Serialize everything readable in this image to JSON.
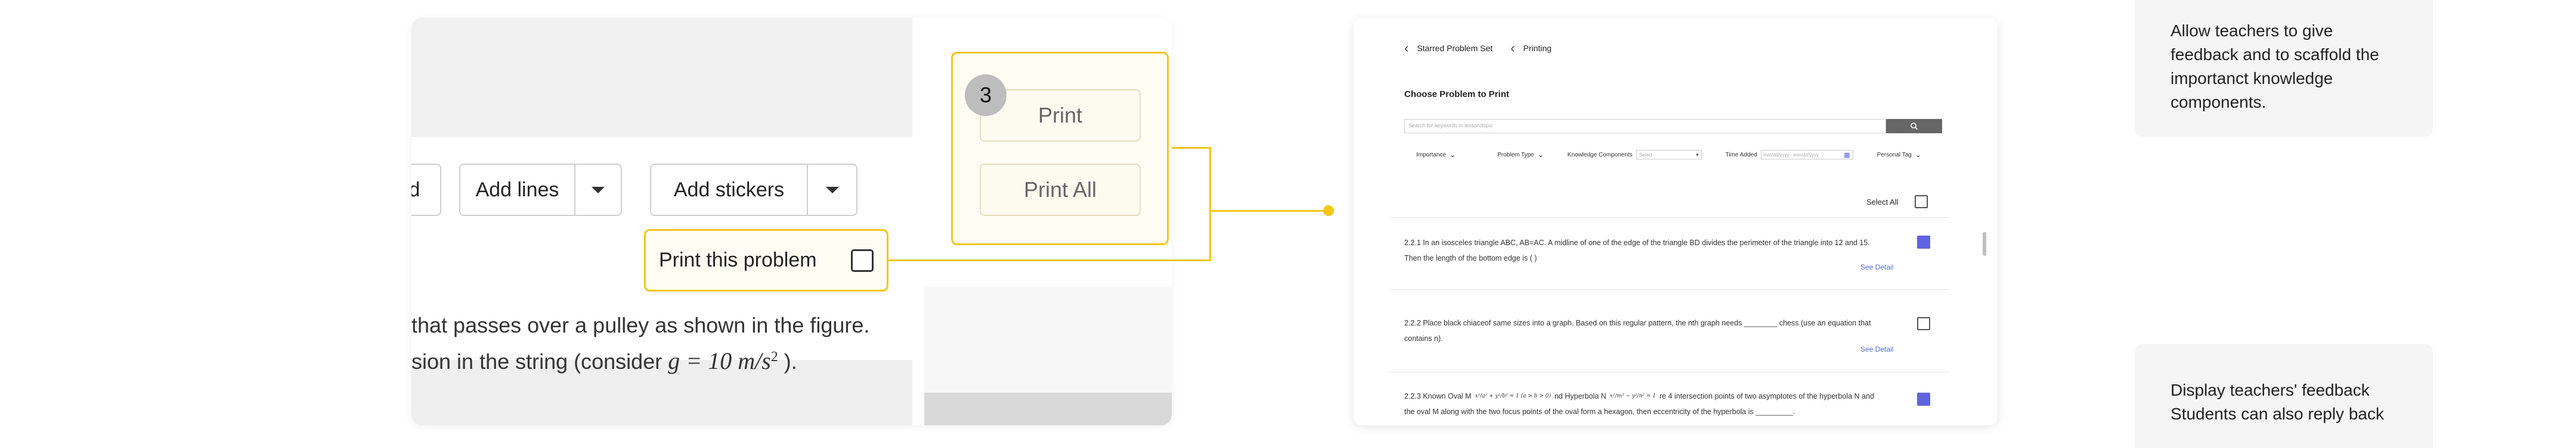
{
  "left_panel": {
    "partial_button_label": "d",
    "add_lines_label": "Add lines",
    "add_stickers_label": "Add stickers",
    "print_this_problem_label": "Print this problem",
    "question_line_1": "that passes over a pulley as shown in the figure.",
    "question_line_2_prefix": "sion in the string (consider ",
    "question_formula": "g = 10 m/s",
    "question_formula_exp": "2",
    "question_line_2_suffix": " ).",
    "step_number": "3",
    "print_label": "Print",
    "print_all_label": "Print All"
  },
  "accent_color": "#f5c518",
  "right_panel": {
    "breadcrumb_parent": "Starred Problem Set",
    "breadcrumb_current": "Printing",
    "section_title": "Choose Problem to Print",
    "search_placeholder": "Search for keywords in lesson/topic",
    "filters": {
      "importance": "Importance",
      "problem_type": "Problem Type",
      "knowledge_components": "Knowledge Components",
      "knowledge_select_placeholder": "Select",
      "time_added": "Time Added",
      "date_range_placeholder": "mm/dd/yyyy - mm/dd/yyyy",
      "personal_tag": "Personal Tag"
    },
    "select_all_label": "Select All",
    "problems": [
      {
        "line1": "2.2.1 In an isosceles triangle ABC, AB=AC. A midline of one of the edge of the triangle BD divides the perimeter of the triangle into 12 and 15.",
        "line2": "Then the length of the bottom edge is (        )",
        "link": "See Detail",
        "checked": true
      },
      {
        "line1": "2.2.2 Place black chiaceof same sizes into a graph. Based on this regular pattern, the nth graph needs ________ chess (use an equation that",
        "line2": "contains n).",
        "link": "See Detail",
        "checked": false
      },
      {
        "line1_a": "2.2.3 Known Oval M",
        "line1_b": "nd Hyperbola N",
        "line1_c": "re 4 intersection points of two asymptotes of the hyperbola N and",
        "line2": "the oval M along with the two focus points of the oval form a hexagon, then eccentricity of the hyperbola is _________.",
        "checked": true
      }
    ],
    "checked_color": "#5f63e0"
  },
  "notes": {
    "top": "Allow teachers to give feedback and to scaffold the importanct knowledge components.",
    "bottom": "Display teachers' feedback Students can also reply back"
  }
}
